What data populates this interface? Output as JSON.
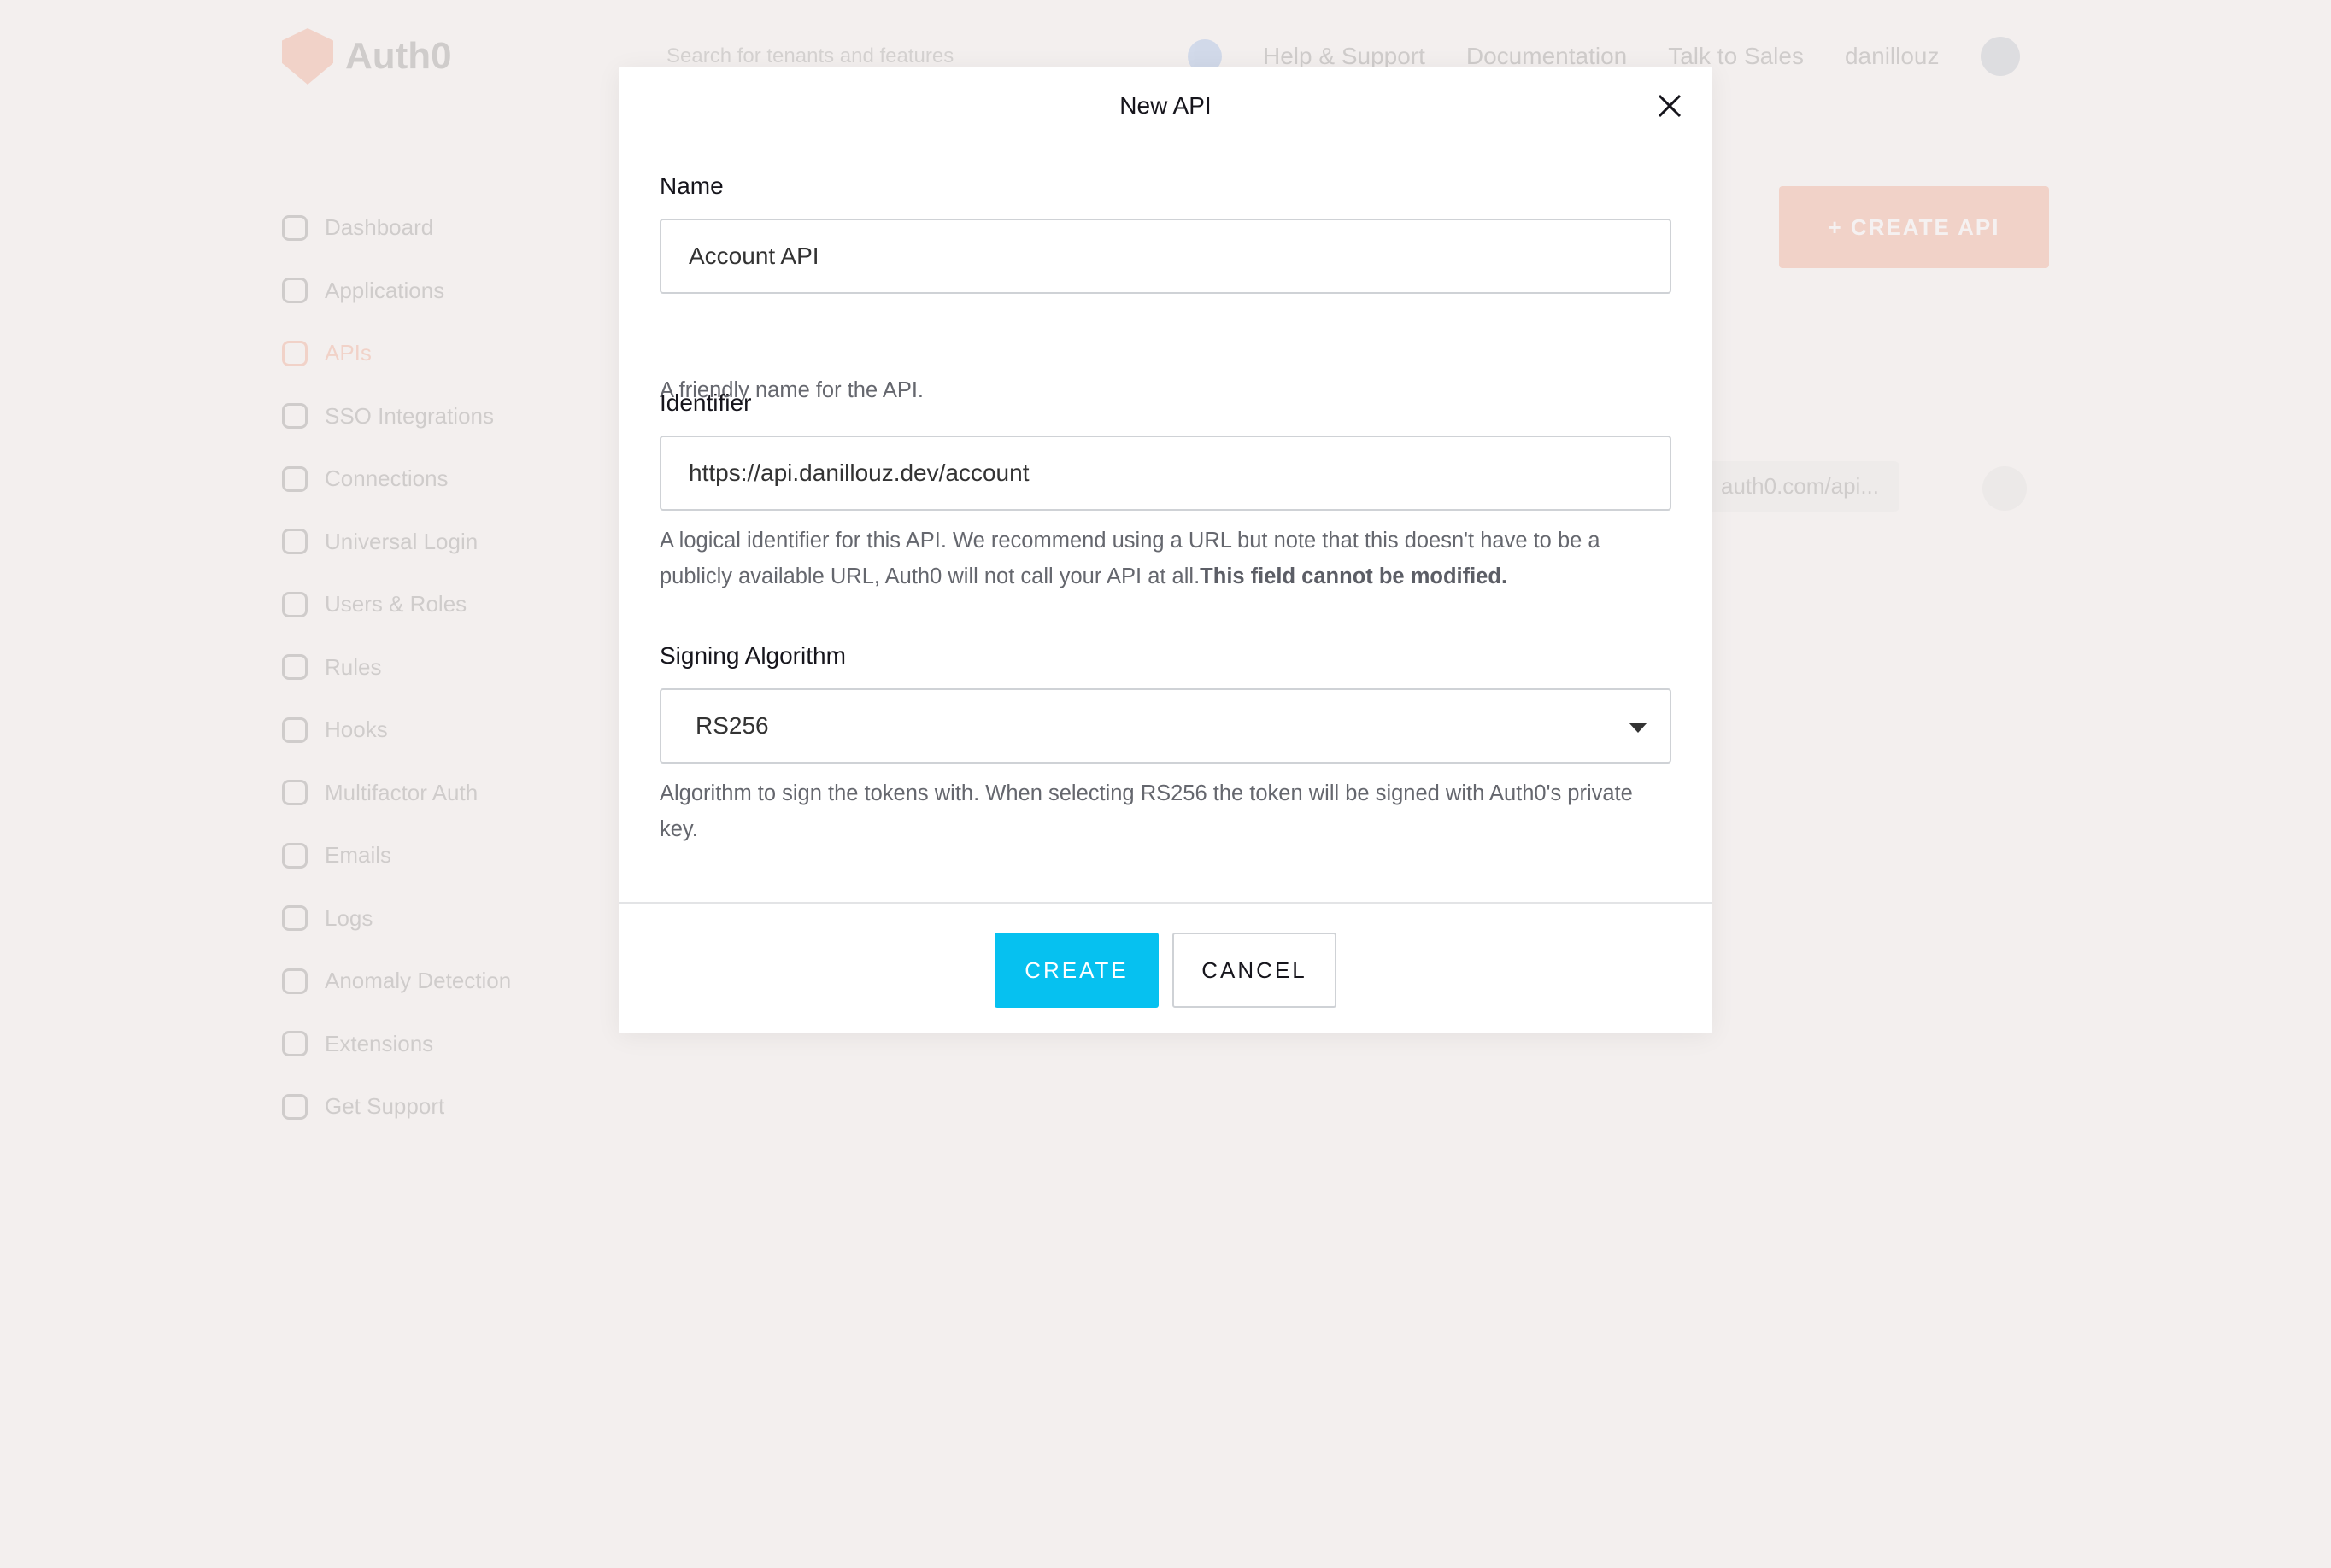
{
  "background": {
    "brand": "Auth0",
    "search_placeholder": "Search for tenants and features",
    "topnav": [
      "Help & Support",
      "Documentation",
      "Talk to Sales"
    ],
    "user": "danillouz",
    "sidebar": [
      "Dashboard",
      "Applications",
      "APIs",
      "SSO Integrations",
      "Connections",
      "Universal Login",
      "Users & Roles",
      "Rules",
      "Hooks",
      "Multifactor Auth",
      "Emails",
      "Logs",
      "Anomaly Detection",
      "Extensions",
      "Get Support"
    ],
    "create_api_button": "+ CREATE API",
    "api_identifier_chip": "auth0.com/api..."
  },
  "modal": {
    "title": "New API",
    "name": {
      "label": "Name",
      "value": "Account API",
      "help": "A friendly name for the API."
    },
    "identifier": {
      "label": "Identifier",
      "value": "https://api.danillouz.dev/account",
      "help": "A logical identifier for this API. We recommend using a URL but note that this doesn't have to be a publicly available URL, Auth0 will not call your API at all.",
      "help_bold": "This field cannot be modified."
    },
    "signing_algorithm": {
      "label": "Signing Algorithm",
      "value": "RS256",
      "help": "Algorithm to sign the tokens with. When selecting RS256 the token will be signed with Auth0's private key."
    },
    "create_label": "CREATE",
    "cancel_label": "CANCEL"
  },
  "colors": {
    "background": "#f3efee",
    "primary_button": "#06c1f0",
    "brand_accent": "#eb5424",
    "text": "#16151c",
    "help_text": "#65676e"
  }
}
